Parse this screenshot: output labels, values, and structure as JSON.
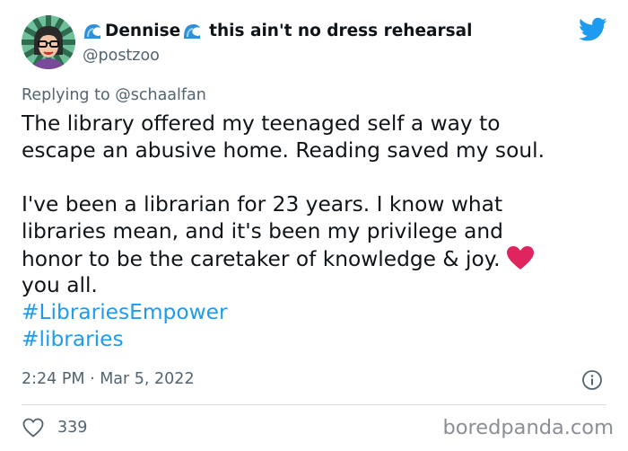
{
  "author": {
    "display_name_part1": "Dennise",
    "display_name_part2": "this ain't no dress rehearsal",
    "handle": "@postzoo",
    "name_emoji": "water-wave-emoji"
  },
  "reply": {
    "prefix": "Replying to",
    "target": "@schaalfan"
  },
  "tweet": {
    "lines": [
      "The library offered my teenaged self a way to",
      "escape an abusive home. Reading saved my soul.",
      "I've been a librarian for 23 years. I know what",
      "libraries mean, and it's been my privilege and",
      "honor to be the caretaker of knowledge & joy.",
      " you all."
    ],
    "hashtags": [
      "#LibrariesEmpower",
      "#libraries"
    ]
  },
  "meta": {
    "timestamp": "2:24 PM · Mar 5, 2022",
    "like_count": "339"
  },
  "watermark": "boredpanda.com",
  "colors": {
    "link": "#1d9bf0",
    "secondary_text": "#536471",
    "heart": "#e0245e"
  }
}
